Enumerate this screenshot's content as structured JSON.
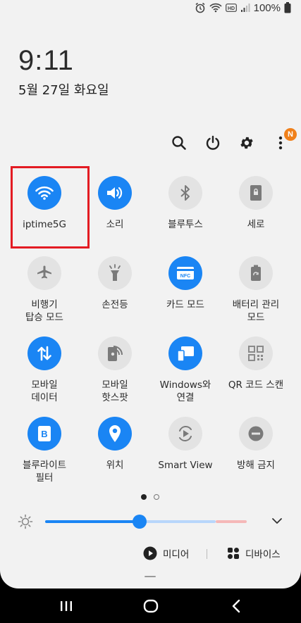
{
  "status_bar": {
    "battery_text": "100%",
    "icons": [
      "alarm-icon",
      "wifi-icon",
      "hd-icon",
      "signal-icon",
      "battery-icon"
    ]
  },
  "clock": {
    "time": "9:11",
    "date": "5월 27일 화요일"
  },
  "top_icons": {
    "notification_badge": "N"
  },
  "tiles": [
    {
      "label": "iptime5G",
      "icon": "wifi-icon",
      "state": "on"
    },
    {
      "label": "소리",
      "icon": "sound-icon",
      "state": "on"
    },
    {
      "label": "블루투스",
      "icon": "bluetooth-icon",
      "state": "off"
    },
    {
      "label": "세로",
      "icon": "portrait-lock-icon",
      "state": "off"
    },
    {
      "label": "비행기\n탑승 모드",
      "icon": "airplane-icon",
      "state": "off"
    },
    {
      "label": "손전등",
      "icon": "flashlight-icon",
      "state": "off"
    },
    {
      "label": "카드 모드",
      "icon": "nfc-icon",
      "state": "on"
    },
    {
      "label": "배터리 관리\n모드",
      "icon": "battery-saver-icon",
      "state": "off"
    },
    {
      "label": "모바일\n데이터",
      "icon": "mobile-data-icon",
      "state": "on"
    },
    {
      "label": "모바일\n핫스팟",
      "icon": "hotspot-icon",
      "state": "off"
    },
    {
      "label": "Windows와\n연결",
      "icon": "link-to-windows-icon",
      "state": "on"
    },
    {
      "label": "QR 코드 스캔",
      "icon": "qr-code-icon",
      "state": "off"
    },
    {
      "label": "블루라이트\n필터",
      "icon": "blue-light-filter-icon",
      "state": "on"
    },
    {
      "label": "위치",
      "icon": "location-icon",
      "state": "on"
    },
    {
      "label": "Smart View",
      "icon": "smart-view-icon",
      "state": "off"
    },
    {
      "label": "방해 금지",
      "icon": "do-not-disturb-icon",
      "state": "off"
    }
  ],
  "brightness": {
    "level": 0.47
  },
  "bottom": {
    "media_label": "미디어",
    "devices_label": "디바이스"
  },
  "colors": {
    "accent": "#1a85f4",
    "highlight": "#e31b23",
    "badge": "#f0801a"
  }
}
